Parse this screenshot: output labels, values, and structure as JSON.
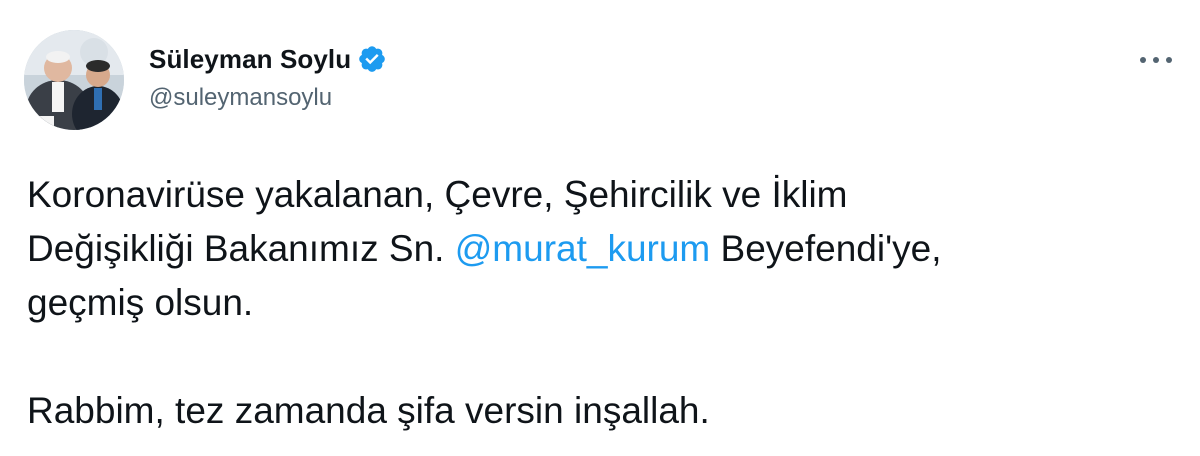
{
  "author": {
    "display_name": "Süleyman Soylu",
    "handle": "@suleymansoylu",
    "verified_icon": "verified-badge-icon"
  },
  "colors": {
    "text": "#0f1419",
    "secondary": "#536471",
    "mention": "#1d9bf0",
    "verified": "#1d9bf0"
  },
  "tweet": {
    "line1": "Koronavirüse yakalanan, Çevre, Şehircilik ve İklim",
    "line2_before": "Değişikliği Bakanımız Sn. ",
    "mention": "@murat_kurum",
    "line2_after": " Beyefendi'ye,",
    "line3": "geçmiş olsun.",
    "line4": "Rabbim, tez zamanda şifa versin inşallah."
  },
  "menu_icon": "more-options-icon"
}
